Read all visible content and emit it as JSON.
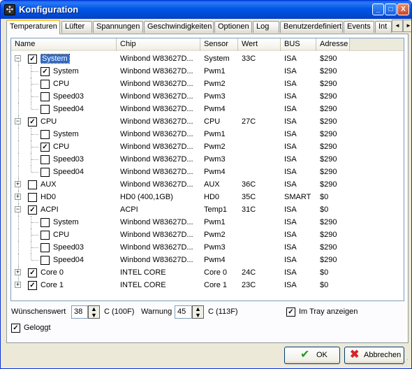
{
  "window": {
    "title": "Konfiguration"
  },
  "title_buttons": {
    "minimize": "_",
    "maximize": "□",
    "close": "X"
  },
  "tabs": [
    "Temperaturen",
    "Lüfter",
    "Spannungen",
    "Geschwindigkeiten",
    "Optionen",
    "Log",
    "Benutzerdefiniert",
    "Events",
    "Int"
  ],
  "tab_scroll": {
    "left": "◄",
    "right": "►"
  },
  "columns": [
    "Name",
    "Chip",
    "Sensor",
    "Wert",
    "BUS",
    "Adresse"
  ],
  "rows": [
    {
      "level": 0,
      "exp": "-",
      "checked": true,
      "name": "System",
      "selected": true,
      "chip": "Winbond W83627D...",
      "sensor": "System",
      "wert": "33C",
      "bus": "ISA",
      "adr": "$290"
    },
    {
      "level": 1,
      "checked": true,
      "name": "System",
      "chip": "Winbond W83627D...",
      "sensor": "Pwm1",
      "wert": "",
      "bus": "ISA",
      "adr": "$290"
    },
    {
      "level": 1,
      "checked": false,
      "name": "CPU",
      "chip": "Winbond W83627D...",
      "sensor": "Pwm2",
      "wert": "",
      "bus": "ISA",
      "adr": "$290"
    },
    {
      "level": 1,
      "checked": false,
      "name": "Speed03",
      "chip": "Winbond W83627D...",
      "sensor": "Pwm3",
      "wert": "",
      "bus": "ISA",
      "adr": "$290"
    },
    {
      "level": 1,
      "checked": false,
      "name": "Speed04",
      "chip": "Winbond W83627D...",
      "sensor": "Pwm4",
      "wert": "",
      "bus": "ISA",
      "adr": "$290"
    },
    {
      "level": 0,
      "exp": "-",
      "checked": true,
      "name": "CPU",
      "chip": "Winbond W83627D...",
      "sensor": "CPU",
      "wert": "27C",
      "bus": "ISA",
      "adr": "$290"
    },
    {
      "level": 1,
      "checked": false,
      "name": "System",
      "chip": "Winbond W83627D...",
      "sensor": "Pwm1",
      "wert": "",
      "bus": "ISA",
      "adr": "$290"
    },
    {
      "level": 1,
      "checked": true,
      "name": "CPU",
      "chip": "Winbond W83627D...",
      "sensor": "Pwm2",
      "wert": "",
      "bus": "ISA",
      "adr": "$290"
    },
    {
      "level": 1,
      "checked": false,
      "name": "Speed03",
      "chip": "Winbond W83627D...",
      "sensor": "Pwm3",
      "wert": "",
      "bus": "ISA",
      "adr": "$290"
    },
    {
      "level": 1,
      "checked": false,
      "name": "Speed04",
      "chip": "Winbond W83627D...",
      "sensor": "Pwm4",
      "wert": "",
      "bus": "ISA",
      "adr": "$290"
    },
    {
      "level": 0,
      "exp": "+",
      "checked": false,
      "name": "AUX",
      "chip": "Winbond W83627D...",
      "sensor": "AUX",
      "wert": "36C",
      "bus": "ISA",
      "adr": "$290"
    },
    {
      "level": 0,
      "exp": "+",
      "checked": false,
      "name": "HD0",
      "chip": "HD0 (400,1GB)",
      "sensor": "HD0",
      "wert": "35C",
      "bus": "SMART",
      "adr": "$0"
    },
    {
      "level": 0,
      "exp": "-",
      "checked": true,
      "name": "ACPI",
      "chip": "ACPI",
      "sensor": "Temp1",
      "wert": "31C",
      "bus": "ISA",
      "adr": "$0"
    },
    {
      "level": 1,
      "checked": false,
      "name": "System",
      "chip": "Winbond W83627D...",
      "sensor": "Pwm1",
      "wert": "",
      "bus": "ISA",
      "adr": "$290"
    },
    {
      "level": 1,
      "checked": false,
      "name": "CPU",
      "chip": "Winbond W83627D...",
      "sensor": "Pwm2",
      "wert": "",
      "bus": "ISA",
      "adr": "$290"
    },
    {
      "level": 1,
      "checked": false,
      "name": "Speed03",
      "chip": "Winbond W83627D...",
      "sensor": "Pwm3",
      "wert": "",
      "bus": "ISA",
      "adr": "$290"
    },
    {
      "level": 1,
      "checked": false,
      "name": "Speed04",
      "chip": "Winbond W83627D...",
      "sensor": "Pwm4",
      "wert": "",
      "bus": "ISA",
      "adr": "$290"
    },
    {
      "level": 0,
      "exp": "+",
      "checked": true,
      "name": "Core 0",
      "chip": "INTEL CORE",
      "sensor": "Core 0",
      "wert": "24C",
      "bus": "ISA",
      "adr": "$0"
    },
    {
      "level": 0,
      "exp": "+",
      "checked": true,
      "name": "Core 1",
      "chip": "INTEL CORE",
      "sensor": "Core 1",
      "wert": "23C",
      "bus": "ISA",
      "adr": "$0"
    }
  ],
  "options": {
    "wunschwert_label": "Wünschenswert",
    "wunschwert_value": "38",
    "wunschwert_unit": "C (100F)",
    "warnung_label": "Warnung",
    "warnung_value": "45",
    "warnung_unit": "C (113F)",
    "tray_label": "Im Tray anzeigen",
    "tray_checked": true,
    "geloggt_label": "Geloggt",
    "geloggt_checked": true
  },
  "buttons": {
    "ok": "OK",
    "cancel": "Abbrechen"
  }
}
